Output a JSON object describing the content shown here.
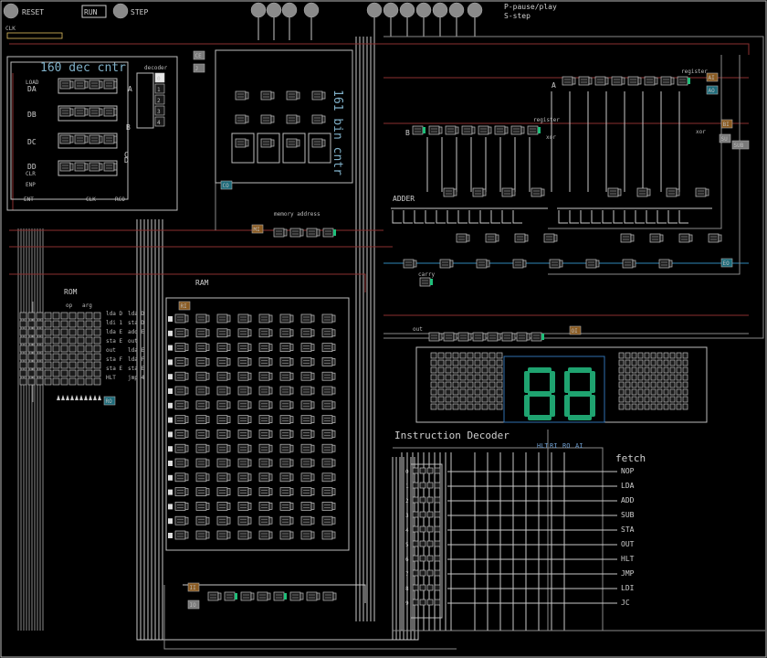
{
  "controls": {
    "reset_label": "RESET",
    "run_label": "RUN",
    "step_label": "STEP",
    "help_line1": "P-pause/play",
    "help_line2": "S-step",
    "clk_label": "CLK"
  },
  "modules": {
    "dec_counter_title": "160 dec cntr",
    "decoder_label": "decoder",
    "bin_counter_title": "161 bin cntr",
    "memory_address_label": "memory address",
    "ram_title": "RAM",
    "rom_title": "ROM",
    "adder_title": "ADDER",
    "register_label": "register",
    "carry_label": "carry",
    "out_label": "out",
    "instruction_decoder_title": "Instruction Decoder",
    "fetch_label": "fetch",
    "xor_label": "xor"
  },
  "dec_counter_pins": {
    "load": "LOAD",
    "da": "DA",
    "db": "DB",
    "dc": "DC",
    "dd": "DD",
    "clr": "CLR",
    "enp": "ENP",
    "ent": "ENT",
    "clk": "CLK",
    "rco": "RCO"
  },
  "decoder_outputs": [
    "0",
    "1",
    "2",
    "3",
    "4"
  ],
  "tags": {
    "ce": "CE",
    "j": "J",
    "co": "CO",
    "mi": "MI",
    "ri": "RI",
    "ro": "RO",
    "ai": "AI",
    "ao": "AO",
    "bi": "BI",
    "su": "SU",
    "sub": "SUB",
    "eo": "EO",
    "oi": "OI",
    "ii": "II",
    "io": "IO"
  },
  "register_bits": {
    "a": "A",
    "b": "B",
    "c": "C",
    "d": "D"
  },
  "rom": {
    "headers": [
      "op",
      "arg"
    ],
    "programs": [
      {
        "code": "lda D",
        "asm": "lda D"
      },
      {
        "code": "ldi 1",
        "asm": "sta D"
      },
      {
        "code": "lda E",
        "asm": "add E"
      },
      {
        "code": "sta E",
        "asm": "out"
      },
      {
        "code": "out",
        "asm": "lda E"
      },
      {
        "code": "sta F",
        "asm": "lda F"
      },
      {
        "code": "sta E",
        "asm": "sta E"
      },
      {
        "code": "HLT",
        "asm": "jmp 4"
      }
    ]
  },
  "display": {
    "digits": [
      "8",
      "8"
    ]
  },
  "instructions": [
    "NOP",
    "LDA",
    "ADD",
    "SUB",
    "STA",
    "OUT",
    "HLT",
    "JMP",
    "LDI",
    "JC"
  ],
  "instruction_index": [
    "0",
    "1",
    "2",
    "3",
    "4",
    "5",
    "6",
    "7",
    "8",
    "9"
  ],
  "decoder_bus_labels": [
    "HLT",
    "RI",
    "RO",
    "AI"
  ],
  "colors": {
    "background": "#000000",
    "wire": "#c9c9c9",
    "active_led": "#1fbf7a",
    "seven_segment": "#1fa370",
    "accent_blue": "#2f87b8",
    "bus_red": "#8b2f2f",
    "tag_brown": "#8a5a20",
    "tag_teal": "#1d6b7a",
    "tag_gray": "#7a7a7a"
  }
}
